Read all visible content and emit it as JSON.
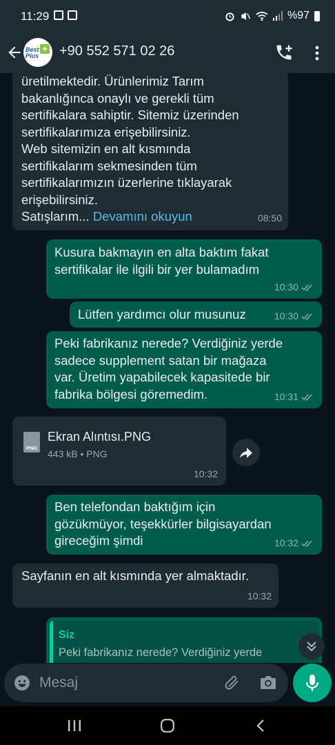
{
  "status_bar": {
    "time": "11:29",
    "battery": "%97"
  },
  "header": {
    "contact_name": "+90 552 571 02 26",
    "avatar_brand": "Best Plus"
  },
  "messages": [
    {
      "direction": "incoming",
      "lines": [
        "üretilmektedir. Ürünlerimiz Tarım",
        "bakanlığınca onaylı ve gerekli tüm",
        "sertifikalara sahiptir. Sitemiz üzerinden",
        "sertifikalarımıza erişebilirsiniz.",
        "Web sitemizin en alt kısmında",
        "sertifikalarım sekmesinden tüm",
        "sertifikalarımızın üzerlerine tıklayarak",
        "erişebilirsiniz."
      ],
      "last_line": "Satışlarım...",
      "read_more": "Devamını okuyun",
      "time": "08:50"
    },
    {
      "direction": "outgoing",
      "lines": [
        "Kusura bakmayın en alta baktım fakat",
        "sertifikalar ile ilgili bir yer bulamadım"
      ],
      "time": "10:30"
    },
    {
      "direction": "outgoing",
      "lines": [
        "Lütfen yardımcı olur musunuz"
      ],
      "time": "10:30"
    },
    {
      "direction": "outgoing",
      "lines": [
        "Peki fabrikanız nerede? Verdiğiniz yerde",
        "sadece supplement satan bir mağaza",
        "var. Üretim yapabilecek kapasitede bir",
        "fabrika bölgesi göremedim."
      ],
      "time": "10:31"
    },
    {
      "direction": "incoming",
      "type": "document",
      "file_icon_label": "PNG",
      "file_name": "Ekran Alıntısı.PNG",
      "file_meta": "443 kB • PNG",
      "time": "10:32"
    },
    {
      "direction": "outgoing",
      "lines": [
        "Ben telefondan baktığım için",
        "gözükmüyor, teşekkürler bilgisayardan",
        "gireceğim şimdi"
      ],
      "time": "10:32"
    },
    {
      "direction": "incoming",
      "lines": [
        "Sayfanın en alt kısmında yer almaktadır."
      ],
      "time": "10:32"
    },
    {
      "direction": "outgoing",
      "type": "reply",
      "quote_author": "Siz",
      "quote_text": "Peki fabrikanız nerede? Verdiğiniz yerde"
    }
  ],
  "composer": {
    "placeholder": "Mesaj"
  },
  "colors": {
    "background": "#0b141a",
    "incoming_bubble": "#1f2c33",
    "outgoing_bubble": "#005c4b",
    "accent": "#00a884",
    "link": "#53bdeb",
    "read_ticks": "#53bdeb"
  },
  "icons": [
    "back-arrow-icon",
    "add-call-icon",
    "more-vert-icon",
    "forward-icon",
    "scroll-down-icon",
    "emoji-icon",
    "attach-icon",
    "camera-icon",
    "mic-icon"
  ]
}
